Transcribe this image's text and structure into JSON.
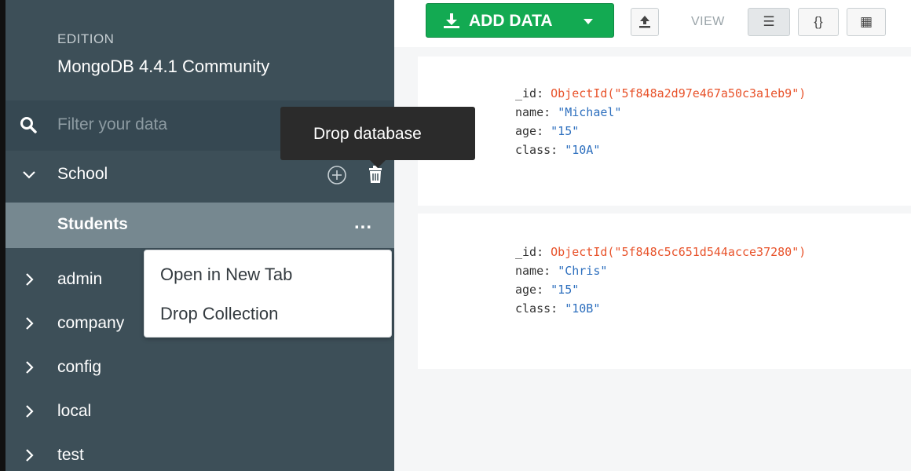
{
  "sidebar": {
    "edition_label": "EDITION",
    "edition_value": "MongoDB 4.4.1 Community",
    "filter_placeholder": "Filter your data",
    "databases": [
      {
        "name": "School",
        "expanded": true
      },
      {
        "name": "admin"
      },
      {
        "name": "company"
      },
      {
        "name": "config"
      },
      {
        "name": "local"
      },
      {
        "name": "test"
      }
    ],
    "selected_collection": "Students",
    "collection_menu_label": "..."
  },
  "tooltip": {
    "text": "Drop database"
  },
  "context_menu": {
    "items": [
      "Open in New Tab",
      "Drop Collection"
    ]
  },
  "toolbar": {
    "add_data_label": "ADD DATA",
    "view_label": "VIEW",
    "view_list_icon": "☰",
    "view_json_icon": "{}",
    "view_table_icon": "▦"
  },
  "documents": [
    {
      "id_key": "_id:",
      "id_value": "ObjectId(\"5f848a2d97e467a50c3a1eb9\")",
      "name_key": "name:",
      "name_value": "\"Michael\"",
      "age_key": "age:",
      "age_value": "\"15\"",
      "class_key": "class:",
      "class_value": "\"10A\""
    },
    {
      "id_key": "_id:",
      "id_value": "ObjectId(\"5f848c5c651d544acce37280\")",
      "name_key": "name:",
      "name_value": "\"Chris\"",
      "age_key": "age:",
      "age_value": "\"15\"",
      "class_key": "class:",
      "class_value": "\"10B\""
    }
  ],
  "colors": {
    "sidebar_bg": "#3d4f58",
    "selected_bg": "#768890",
    "accent_green": "#13aa52",
    "objectid_color": "#e8532b",
    "string_color": "#2d6fbe"
  }
}
